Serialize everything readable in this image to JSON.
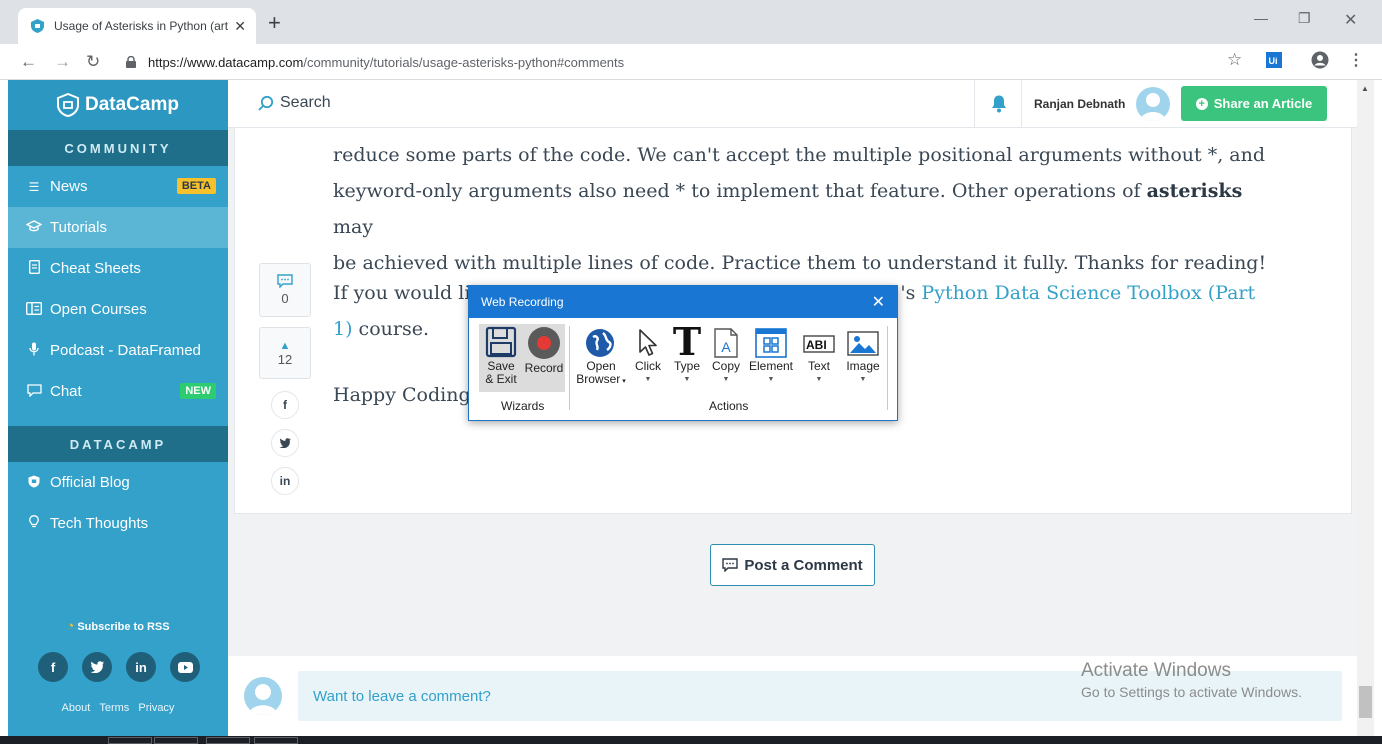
{
  "browser": {
    "tab_title": "Usage of Asterisks in Python (arti",
    "url_host": "https://www.datacamp.com",
    "url_path": "/community/tutorials/usage-asterisks-python#comments",
    "new_tab": "+",
    "tab_close": "✕"
  },
  "sidebar": {
    "logo": "DataCamp",
    "community_heading": "COMMUNITY",
    "community_items": [
      {
        "label": "News",
        "icon": "menu-icon",
        "badge": "BETA"
      },
      {
        "label": "Tutorials",
        "icon": "graduation-cap-icon",
        "active": true
      },
      {
        "label": "Cheat Sheets",
        "icon": "document-icon"
      },
      {
        "label": "Open Courses",
        "icon": "columns-icon"
      },
      {
        "label": "Podcast - DataFramed",
        "icon": "microphone-icon"
      },
      {
        "label": "Chat",
        "icon": "chat-icon",
        "badge": "NEW"
      }
    ],
    "datacamp_heading": "DATACAMP",
    "datacamp_items": [
      {
        "label": "Official Blog",
        "icon": "shield-icon"
      },
      {
        "label": "Tech Thoughts",
        "icon": "lightbulb-icon"
      }
    ],
    "subscribe": "Subscribe to RSS",
    "social": [
      "f",
      "t",
      "in",
      "▶"
    ],
    "footer_links": [
      "About",
      "Terms",
      "Privacy"
    ]
  },
  "header": {
    "search_label": "Search",
    "user_name": "Ranjan Debnath",
    "share_button": "Share an Article"
  },
  "article": {
    "p1_line1": "reduce some parts of the code. We can't accept the multiple positional arguments without *, and",
    "p1_line2_pre": "keyword-only arguments also need * to implement that feature. Other operations of ",
    "p1_line2_bold": "asterisks",
    "p1_line2_post": " may",
    "p1_line3": "be achieved with multiple lines of code. Practice them to understand it fully. Thanks for reading!",
    "p2_pre": "If you would li",
    "p2_mid": "'s ",
    "p2_link": "Python Data Science Toolbox (Part",
    "p2_link2": "1)",
    "p2_post": " course.",
    "p3": "Happy Coding"
  },
  "votes": {
    "comments_count": "0",
    "upvote_count": "12"
  },
  "share_icons": [
    "f",
    "t",
    "in"
  ],
  "post_comment": "Post a Comment",
  "comment_prompt": "Want to leave a comment?",
  "watermark": {
    "line1": "Activate Windows",
    "line2": "Go to Settings to activate Windows."
  },
  "recorder": {
    "title": "Web Recording",
    "tools": {
      "save_exit_l1": "Save",
      "save_exit_l2": "& Exit",
      "record": "Record",
      "open_browser_l1": "Open",
      "open_browser_l2": "Browser",
      "click": "Click",
      "type": "Type",
      "copy": "Copy",
      "element": "Element",
      "text": "Text",
      "image": "Image"
    },
    "group_wizards": "Wizards",
    "group_actions": "Actions"
  },
  "colors": {
    "sidebar": "#33a1c9",
    "accent_link": "#33a1c9",
    "share_green": "#3ac47d",
    "dialog_blue": "#1976d2"
  }
}
